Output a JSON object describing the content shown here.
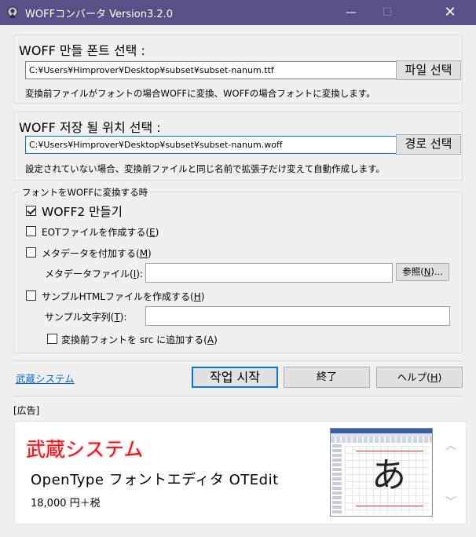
{
  "window": {
    "title": "WOFFコンバータ Version3.2.0",
    "minimize": "—",
    "maximize": "☐",
    "close": "✕"
  },
  "font_select": {
    "title": "WOFF 만들 폰트 선택 :",
    "path": "C:¥Users¥Himprover¥Desktop¥subset¥subset-nanum.ttf",
    "button": "파일 선택",
    "note": "変換前ファイルがフォントの場合WOFFに変換、WOFFの場合フォントに変換します。"
  },
  "save_location": {
    "title": "WOFF 저장 될 위치 선택 :",
    "path": "C:¥Users¥Himprover¥Desktop¥subset¥subset-nanum.woff",
    "button": "경로 선택",
    "note": "設定されていない場合、変換前ファイルと同じ名前で拡張子だけ変えて自動作成します。"
  },
  "options": {
    "legend": "フォントをWOFFに変換する時",
    "woff2": {
      "label": "WOFF2 만들기",
      "checked": true
    },
    "eot": {
      "label": "EOTファイルを作成する(",
      "key": "E",
      "suffix": ")",
      "checked": false
    },
    "metadata": {
      "label": "メタデータを付加する(",
      "key": "M",
      "suffix": ")",
      "checked": false
    },
    "metadata_file": {
      "label": "メタデータファイル(",
      "key": "I",
      "suffix": "):",
      "value": "",
      "browse_prefix": "参照(",
      "browse_key": "N",
      "browse_suffix": ")..."
    },
    "sample_html": {
      "label": "サンプルHTMLファイルを作成する(",
      "key": "H",
      "suffix": ")",
      "checked": false
    },
    "sample_text": {
      "label": "サンプル文字列(",
      "key": "T",
      "suffix": "):",
      "value": ""
    },
    "add_src": {
      "label": "変換前フォントを src に追加する(",
      "key": "A",
      "suffix": ")",
      "checked": false
    }
  },
  "footer": {
    "link": "武蔵システム",
    "start": "작업 시작",
    "exit": "終了",
    "help_prefix": "ヘルプ(",
    "help_key": "H",
    "help_suffix": ")"
  },
  "ad": {
    "label": "[広告]",
    "company": "武蔵システム",
    "product": "OpenType フォントエディタ OTEdit",
    "price": "18,000 円＋税",
    "preview_glyph": "あ",
    "colors": {
      "company": "#e8131a",
      "titlebar": "#5a4f86"
    }
  }
}
